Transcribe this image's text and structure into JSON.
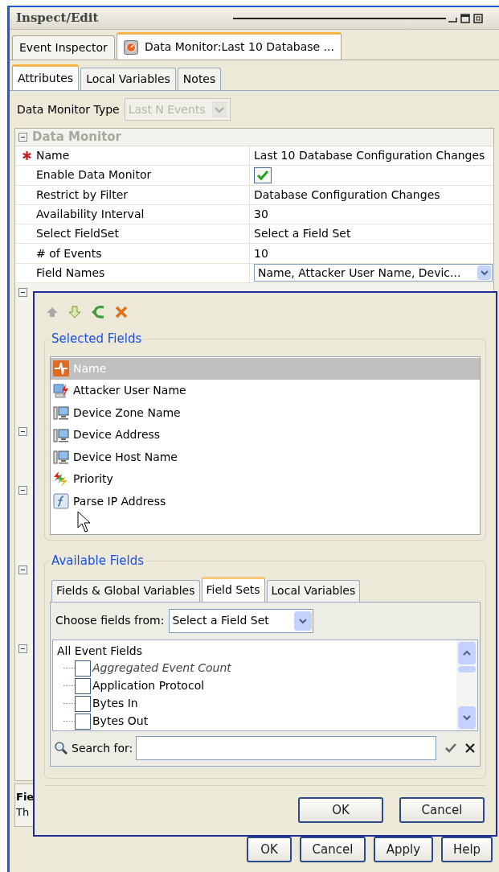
{
  "window": {
    "title": "Inspect/Edit"
  },
  "editor_tabs": [
    {
      "label": "Event Inspector",
      "selected": false
    },
    {
      "label": "Data Monitor:Last 10 Database ...",
      "selected": true
    }
  ],
  "sub_tabs": [
    {
      "label": "Attributes",
      "selected": true
    },
    {
      "label": "Local Variables",
      "selected": false
    },
    {
      "label": "Notes",
      "selected": false
    }
  ],
  "data_monitor_type": {
    "label": "Data Monitor Type",
    "value": "Last N Events",
    "disabled": true
  },
  "property_group": {
    "title": "Data Monitor",
    "expanded": true,
    "rows": [
      {
        "name": "Name",
        "required": true,
        "kind": "text",
        "value": "Last 10 Database Configuration Changes"
      },
      {
        "name": "Enable Data Monitor",
        "required": false,
        "kind": "checkbox",
        "checked": true
      },
      {
        "name": "Restrict by Filter",
        "required": false,
        "kind": "text",
        "value": "Database Configuration Changes"
      },
      {
        "name": "Availability Interval",
        "required": false,
        "kind": "text",
        "value": "30"
      },
      {
        "name": "Select FieldSet",
        "required": false,
        "kind": "text",
        "value": "Select a Field Set"
      },
      {
        "name": "# of Events",
        "required": false,
        "kind": "text",
        "value": "10"
      },
      {
        "name": "Field Names",
        "required": false,
        "kind": "dropdown",
        "value": "Name, Attacker User Name, Devic..."
      }
    ]
  },
  "description_panel": {
    "title": "Fie",
    "text": "Th"
  },
  "field_picker": {
    "selected_fields": {
      "title": "Selected Fields",
      "items": [
        {
          "label": "Name",
          "kind": "event",
          "selected": true
        },
        {
          "label": "Attacker User Name",
          "kind": "user",
          "selected": false
        },
        {
          "label": "Device Zone Name",
          "kind": "device",
          "selected": false
        },
        {
          "label": "Device Address",
          "kind": "device",
          "selected": false
        },
        {
          "label": "Device Host Name",
          "kind": "device",
          "selected": false
        },
        {
          "label": "Priority",
          "kind": "priority",
          "selected": false
        },
        {
          "label": "Parse IP Address",
          "kind": "function",
          "selected": false
        }
      ]
    },
    "available_fields": {
      "title": "Available Fields",
      "tabs": [
        {
          "label": "Fields & Global Variables",
          "selected": false
        },
        {
          "label": "Field Sets",
          "selected": true
        },
        {
          "label": "Local Variables",
          "selected": false
        }
      ],
      "choose_label": "Choose fields from:",
      "choose_value": "Select a Field Set",
      "tree": {
        "label": "All Event Fields",
        "children": [
          {
            "label": "Aggregated Event Count",
            "italic": true,
            "checked": false
          },
          {
            "label": "Application Protocol",
            "italic": false,
            "checked": false
          },
          {
            "label": "Bytes In",
            "italic": false,
            "checked": false
          },
          {
            "label": "Bytes Out",
            "italic": false,
            "checked": false
          }
        ]
      },
      "search_label": "Search for:"
    },
    "buttons": [
      "OK",
      "Cancel"
    ]
  },
  "buttons": [
    "OK",
    "Cancel",
    "Apply",
    "Help"
  ]
}
